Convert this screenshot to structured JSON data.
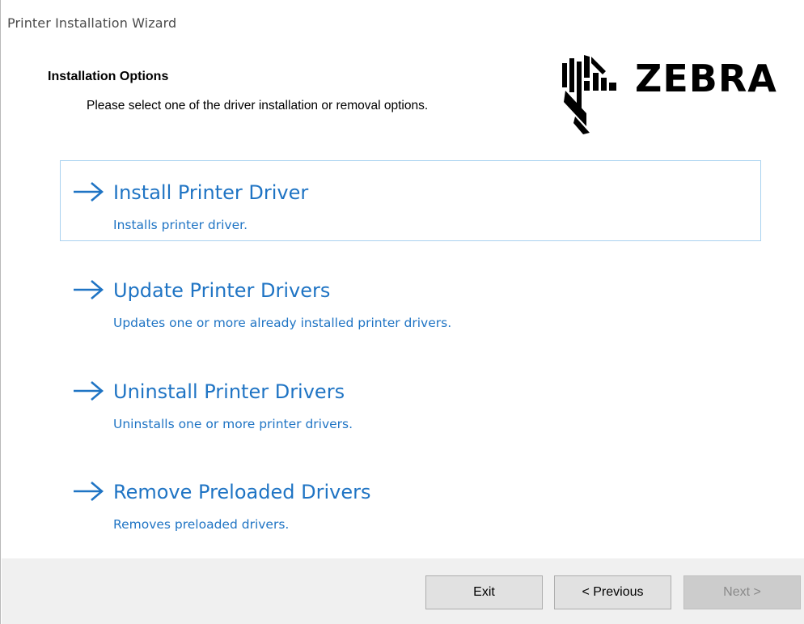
{
  "window": {
    "title": "Printer Installation Wizard"
  },
  "header": {
    "title": "Installation Options",
    "description": "Please select one of the driver installation or removal options.",
    "logo_text": "ZEBRA"
  },
  "options": [
    {
      "title": "Install Printer Driver",
      "description": "Installs printer driver.",
      "selected": true
    },
    {
      "title": "Update Printer Drivers",
      "description": "Updates one or more already installed printer drivers.",
      "selected": false
    },
    {
      "title": "Uninstall Printer Drivers",
      "description": "Uninstalls one or more printer drivers.",
      "selected": false
    },
    {
      "title": "Remove Preloaded Drivers",
      "description": "Removes preloaded drivers.",
      "selected": false
    }
  ],
  "footer": {
    "exit_label": "Exit",
    "previous_label": "< Previous",
    "next_label": "Next >",
    "next_enabled": false
  },
  "colors": {
    "link_blue": "#1f74c4",
    "selection_border": "#a9d2f0",
    "footer_bg": "#f0f0f0"
  }
}
